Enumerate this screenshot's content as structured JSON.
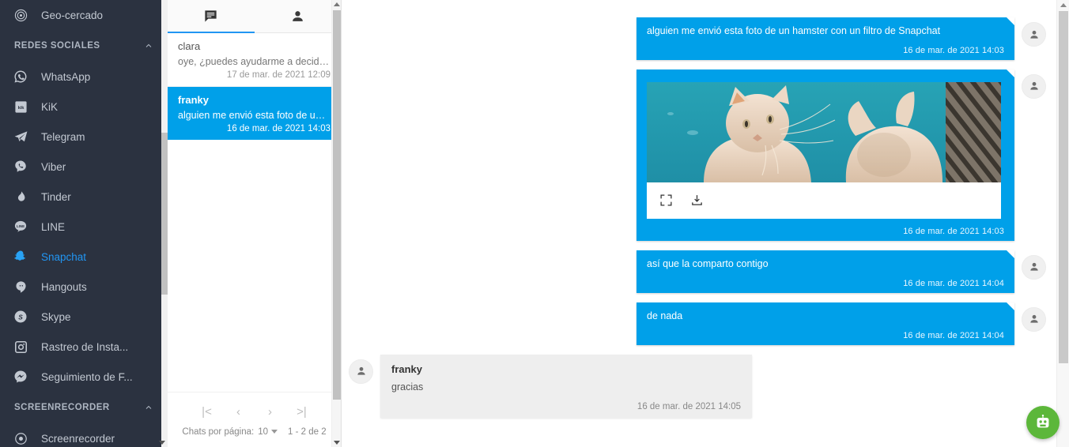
{
  "sidebar": {
    "top_item": {
      "label": "Geo-cercado",
      "icon": "target-icon"
    },
    "groups": [
      {
        "title": "REDES SOCIALES",
        "collapse_icon": "chevron-up-icon",
        "items": [
          {
            "label": "WhatsApp",
            "icon": "whatsapp-icon",
            "active": false
          },
          {
            "label": "KiK",
            "icon": "kik-icon",
            "active": false
          },
          {
            "label": "Telegram",
            "icon": "telegram-icon",
            "active": false
          },
          {
            "label": "Viber",
            "icon": "viber-icon",
            "active": false
          },
          {
            "label": "Tinder",
            "icon": "tinder-icon",
            "active": false
          },
          {
            "label": "LINE",
            "icon": "line-icon",
            "active": false
          },
          {
            "label": "Snapchat",
            "icon": "snapchat-icon",
            "active": true
          },
          {
            "label": "Hangouts",
            "icon": "hangouts-icon",
            "active": false
          },
          {
            "label": "Skype",
            "icon": "skype-icon",
            "active": false
          },
          {
            "label": "Rastreo de Insta...",
            "icon": "instagram-icon",
            "active": false
          },
          {
            "label": "Seguimiento de F...",
            "icon": "messenger-icon",
            "active": false
          }
        ]
      },
      {
        "title": "SCREENRECORDER",
        "collapse_icon": "chevron-up-icon",
        "items": [
          {
            "label": "Screenrecorder",
            "icon": "record-icon",
            "active": false
          }
        ]
      }
    ]
  },
  "list_panel": {
    "tabs": [
      {
        "id": "chats",
        "icon": "chat-icon",
        "active": true
      },
      {
        "id": "contacts",
        "icon": "person-icon",
        "active": false
      }
    ],
    "chats": [
      {
        "name": "clara",
        "preview": "oye, ¿puedes ayudarme a decidir q...",
        "time": "17 de mar. de 2021 12:09",
        "selected": false
      },
      {
        "name": "franky",
        "preview": "alguien me envió esta foto de un h...",
        "time": "16 de mar. de 2021 14:03",
        "selected": true
      }
    ],
    "paginator": {
      "first_label": "|<",
      "prev_label": "‹",
      "next_label": "›",
      "last_label": ">|",
      "per_page_label": "Chats por página:",
      "per_page_value": "10",
      "range_label": "1 - 2 de 2"
    }
  },
  "conversation": {
    "messages": [
      {
        "direction": "out",
        "type": "text",
        "text": "alguien me envió esta foto de un hamster con un filtro de Snapchat",
        "time": "16 de mar. de 2021 14:03"
      },
      {
        "direction": "out",
        "type": "image",
        "alt": "dos gatos naranjas frente a un fondo turquesa",
        "fullscreen_icon": "fullscreen-icon",
        "download_icon": "download-icon",
        "time": "16 de mar. de 2021 14:03"
      },
      {
        "direction": "out",
        "type": "text",
        "text": "así que la comparto contigo",
        "time": "16 de mar. de 2021 14:04"
      },
      {
        "direction": "out",
        "type": "text",
        "text": "de nada",
        "time": "16 de mar. de 2021 14:04"
      },
      {
        "direction": "in",
        "type": "text",
        "sender": "franky",
        "text": "gracias",
        "time": "16 de mar. de 2021 14:05"
      }
    ]
  },
  "fab": {
    "icon": "robot-icon"
  },
  "colors": {
    "sidebar_bg": "#2b3240",
    "accent_blue": "#00a0e9",
    "active_item": "#2196f3",
    "incoming_bubble": "#eeeeee",
    "fab_green": "#5cb73a"
  }
}
